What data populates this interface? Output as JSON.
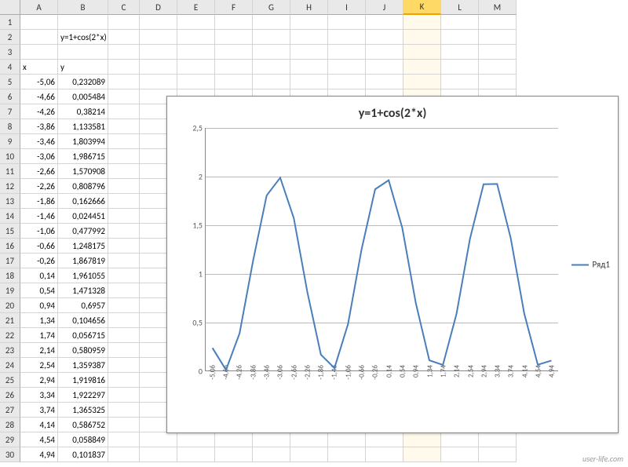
{
  "columns": [
    "A",
    "B",
    "C",
    "D",
    "E",
    "F",
    "G",
    "H",
    "I",
    "J",
    "K",
    "L",
    "M"
  ],
  "selected_col": "K",
  "formula_row": {
    "col": "B",
    "text": "y=1+cos(2*x)"
  },
  "header_labels": {
    "x": "x",
    "y": "y"
  },
  "data_rows": [
    {
      "r": 5,
      "x": "-5,06",
      "y": "0,232089"
    },
    {
      "r": 6,
      "x": "-4,66",
      "y": "0,005484"
    },
    {
      "r": 7,
      "x": "-4,26",
      "y": "0,38214"
    },
    {
      "r": 8,
      "x": "-3,86",
      "y": "1,133581"
    },
    {
      "r": 9,
      "x": "-3,46",
      "y": "1,803994"
    },
    {
      "r": 10,
      "x": "-3,06",
      "y": "1,986715"
    },
    {
      "r": 11,
      "x": "-2,66",
      "y": "1,570908"
    },
    {
      "r": 12,
      "x": "-2,26",
      "y": "0,808796"
    },
    {
      "r": 13,
      "x": "-1,86",
      "y": "0,162666"
    },
    {
      "r": 14,
      "x": "-1,46",
      "y": "0,024451"
    },
    {
      "r": 15,
      "x": "-1,06",
      "y": "0,477992"
    },
    {
      "r": 16,
      "x": "-0,66",
      "y": "1,248175"
    },
    {
      "r": 17,
      "x": "-0,26",
      "y": "1,867819"
    },
    {
      "r": 18,
      "x": "0,14",
      "y": "1,961055"
    },
    {
      "r": 19,
      "x": "0,54",
      "y": "1,471328"
    },
    {
      "r": 20,
      "x": "0,94",
      "y": "0,6957"
    },
    {
      "r": 21,
      "x": "1,34",
      "y": "0,104656"
    },
    {
      "r": 22,
      "x": "1,74",
      "y": "0,056715"
    },
    {
      "r": 23,
      "x": "2,14",
      "y": "0,580959"
    },
    {
      "r": 24,
      "x": "2,54",
      "y": "1,359387"
    },
    {
      "r": 25,
      "x": "2,94",
      "y": "1,919816"
    },
    {
      "r": 26,
      "x": "3,34",
      "y": "1,922297"
    },
    {
      "r": 27,
      "x": "3,74",
      "y": "1,365325"
    },
    {
      "r": 28,
      "x": "4,14",
      "y": "0,586752"
    },
    {
      "r": 29,
      "x": "4,54",
      "y": "0,058849"
    },
    {
      "r": 30,
      "x": "4,94",
      "y": "0,101837"
    }
  ],
  "chart_data": {
    "type": "line",
    "title": "y=1+cos(2*x)",
    "xlabel": "",
    "ylabel": "",
    "ylim": [
      0,
      2.5
    ],
    "yticks": [
      0,
      0.5,
      1,
      1.5,
      2,
      2.5
    ],
    "ytick_labels": [
      "0",
      "0,5",
      "1",
      "1,5",
      "2",
      "2,5"
    ],
    "categories": [
      "-5,06",
      "-4,66",
      "-4,26",
      "-3,86",
      "-3,46",
      "-3,06",
      "-2,66",
      "-2,26",
      "-1,86",
      "-1,46",
      "-1,06",
      "-0,66",
      "-0,26",
      "0,14",
      "0,54",
      "0,94",
      "1,34",
      "1,74",
      "2,14",
      "2,54",
      "2,94",
      "3,34",
      "3,74",
      "4,14",
      "4,54",
      "4,94"
    ],
    "series": [
      {
        "name": "Ряд1",
        "color": "#4a7ebb",
        "values": [
          0.232089,
          0.005484,
          0.38214,
          1.133581,
          1.803994,
          1.986715,
          1.570908,
          0.808796,
          0.162666,
          0.024451,
          0.477992,
          1.248175,
          1.867819,
          1.961055,
          1.471328,
          0.6957,
          0.104656,
          0.056715,
          0.580959,
          1.359387,
          1.919816,
          1.922297,
          1.365325,
          0.586752,
          0.058849,
          0.101837
        ]
      }
    ],
    "legend_position": "right"
  },
  "watermark": "user-life.com"
}
